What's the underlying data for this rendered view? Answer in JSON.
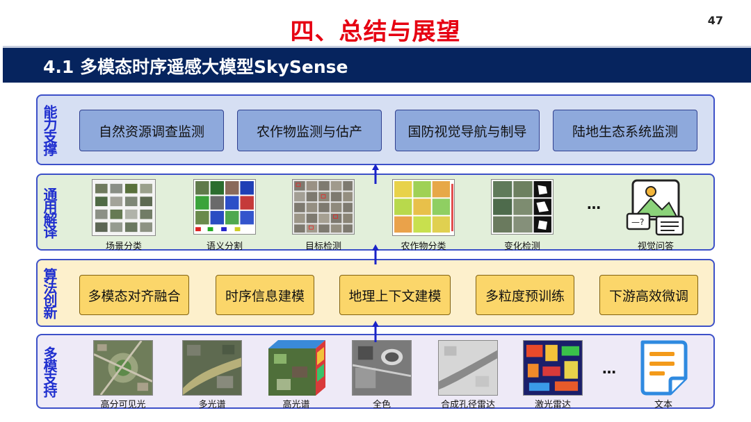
{
  "slide": {
    "title": "四、总结与展望",
    "page_number": "47",
    "section_header": "4.1 多模态时序遥感大模型SkySense"
  },
  "layers": {
    "capability": {
      "label": "能力支撑",
      "items": [
        "自然资源调查监测",
        "农作物监测与估产",
        "国防视觉导航与制导",
        "陆地生态系统监测"
      ]
    },
    "interpretation": {
      "label": "通用解译",
      "items": [
        "场景分类",
        "语义分割",
        "目标检测",
        "农作物分类",
        "变化检测",
        "视觉问答"
      ],
      "ellipsis": "…"
    },
    "innovation": {
      "label": "算法创新",
      "items": [
        "多模态对齐融合",
        "时序信息建模",
        "地理上下文建模",
        "多粒度预训练",
        "下游高效微调"
      ]
    },
    "modality": {
      "label": "多模支持",
      "items": [
        "高分可见光",
        "多光谱",
        "高光谱",
        "全色",
        "合成孔径雷达",
        "激光雷达",
        "文本"
      ],
      "ellipsis": "…"
    }
  },
  "colors": {
    "title_red": "#e60012",
    "header_navy": "#06245e",
    "label_blue": "#1f2fcf",
    "arrow_blue": "#1a23c8"
  }
}
